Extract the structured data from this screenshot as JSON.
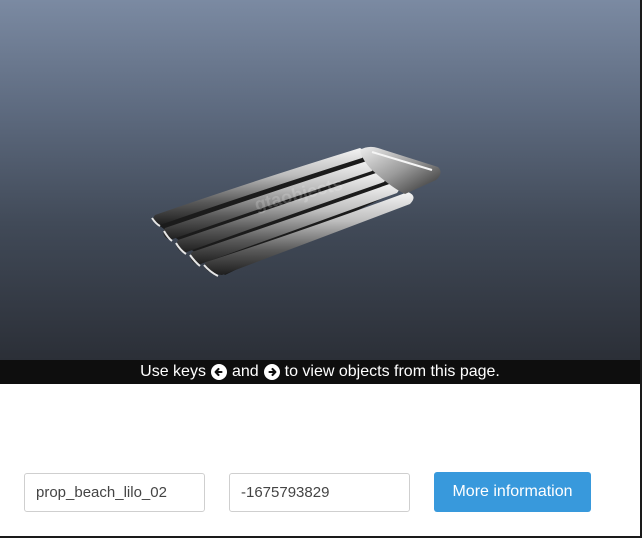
{
  "viewer": {
    "object_name": "prop_beach_lilo_02",
    "watermark": "gtaobjects"
  },
  "hint": {
    "prefix": "Use keys",
    "and": "and",
    "suffix": "to view objects from this page.",
    "left_key_icon": "arrow-left-circle-icon",
    "right_key_icon": "arrow-right-circle-icon"
  },
  "controls": {
    "name_value": "prop_beach_lilo_02",
    "hash_value": "-1675793829",
    "more_info_label": "More information"
  },
  "colors": {
    "button": "#3899dc",
    "hint_bar": "#0e0e0e",
    "viewer_top": "#7b8aa2",
    "viewer_bottom": "#2b2f37"
  }
}
